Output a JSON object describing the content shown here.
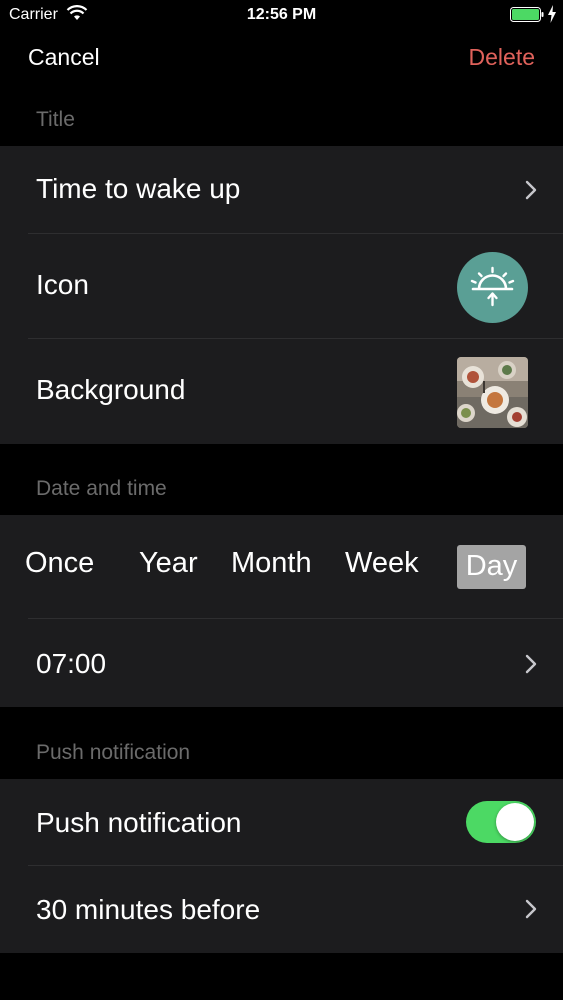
{
  "status_bar": {
    "carrier": "Carrier",
    "time": "12:56 PM",
    "battery_color": "#4cd964"
  },
  "nav": {
    "cancel_label": "Cancel",
    "delete_label": "Delete",
    "delete_color": "#e0625b"
  },
  "sections": {
    "title_header": "Title",
    "title_row": "Time to wake up",
    "icon_row": "Icon",
    "icon_name": "sunrise-icon",
    "icon_color": "#5a9f95",
    "background_row": "Background",
    "date_header": "Date and time",
    "repeat_options": [
      "Once",
      "Year",
      "Month",
      "Week",
      "Day"
    ],
    "repeat_selected": "Day",
    "time_row": "07:00",
    "push_header": "Push notification",
    "push_row": "Push notification",
    "push_enabled": true,
    "reminder_row": "30 minutes before"
  }
}
